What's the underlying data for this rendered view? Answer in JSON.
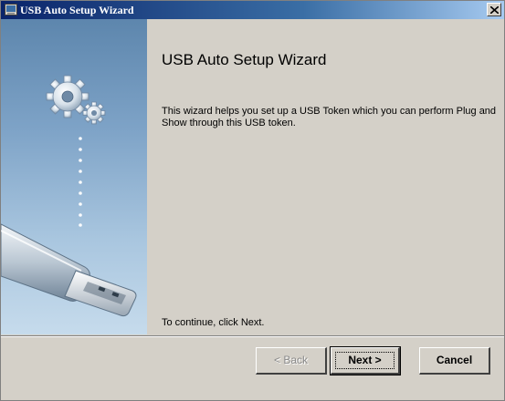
{
  "window": {
    "title": "USB Auto Setup Wizard",
    "icons": {
      "app": "setup-app-icon",
      "close": "close-icon"
    }
  },
  "sidebar": {
    "graphic": "usb-token-illustration",
    "icons": [
      "gears-icon",
      "usb-drive-icon"
    ]
  },
  "page": {
    "heading": "USB Auto Setup Wizard",
    "description": "This wizard helps you set up a USB Token which you can perform Plug and Show through this USB token.",
    "continue_text": "To continue, click Next."
  },
  "buttons": {
    "back": "< Back",
    "next": "Next >",
    "cancel": "Cancel"
  },
  "colors": {
    "title_bar": "#0a246a",
    "dialog_bg": "#d4d0c8"
  }
}
